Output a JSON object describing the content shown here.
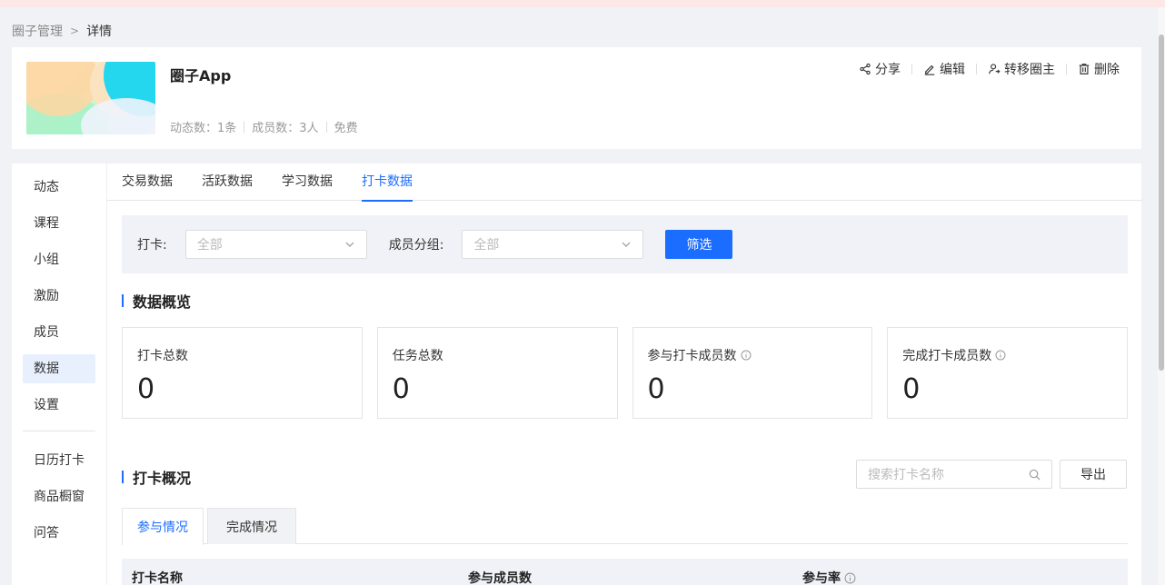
{
  "breadcrumb": {
    "parent": "圈子管理",
    "current": "详情"
  },
  "circle": {
    "name": "圈子App",
    "posts_label": "动态数：1条",
    "members_label": "成员数：3人",
    "price_label": "免费"
  },
  "actions": {
    "share": "分享",
    "edit": "编辑",
    "transfer": "转移圈主",
    "delete": "删除"
  },
  "sidebar": {
    "items": [
      {
        "label": "动态",
        "active": false
      },
      {
        "label": "课程",
        "active": false
      },
      {
        "label": "小组",
        "active": false
      },
      {
        "label": "激励",
        "active": false
      },
      {
        "label": "成员",
        "active": false
      },
      {
        "label": "数据",
        "active": true
      },
      {
        "label": "设置",
        "active": false
      }
    ],
    "extra_items": [
      {
        "label": "日历打卡"
      },
      {
        "label": "商品橱窗"
      },
      {
        "label": "问答"
      }
    ]
  },
  "tabs": [
    {
      "label": "交易数据",
      "active": false
    },
    {
      "label": "活跃数据",
      "active": false
    },
    {
      "label": "学习数据",
      "active": false
    },
    {
      "label": "打卡数据",
      "active": true
    }
  ],
  "filter": {
    "checkin_label": "打卡:",
    "checkin_value": "全部",
    "group_label": "成员分组:",
    "group_value": "全部",
    "submit_label": "筛选"
  },
  "overview": {
    "title": "数据概览",
    "stats": [
      {
        "label": "打卡总数",
        "value": "0",
        "info": false
      },
      {
        "label": "任务总数",
        "value": "0",
        "info": false
      },
      {
        "label": "参与打卡成员数",
        "value": "0",
        "info": true
      },
      {
        "label": "完成打卡成员数",
        "value": "0",
        "info": true
      }
    ]
  },
  "checkin_overview": {
    "title": "打卡概况",
    "search_placeholder": "搜索打卡名称",
    "export_label": "导出",
    "subtabs": [
      {
        "label": "参与情况",
        "active": true
      },
      {
        "label": "完成情况",
        "active": false
      }
    ],
    "columns": [
      "打卡名称",
      "参与成员数",
      "参与率"
    ]
  },
  "colors": {
    "accent": "#1a6dff",
    "filter_bg": "#f0f2f7",
    "active_side_bg": "#e8f0fe"
  }
}
